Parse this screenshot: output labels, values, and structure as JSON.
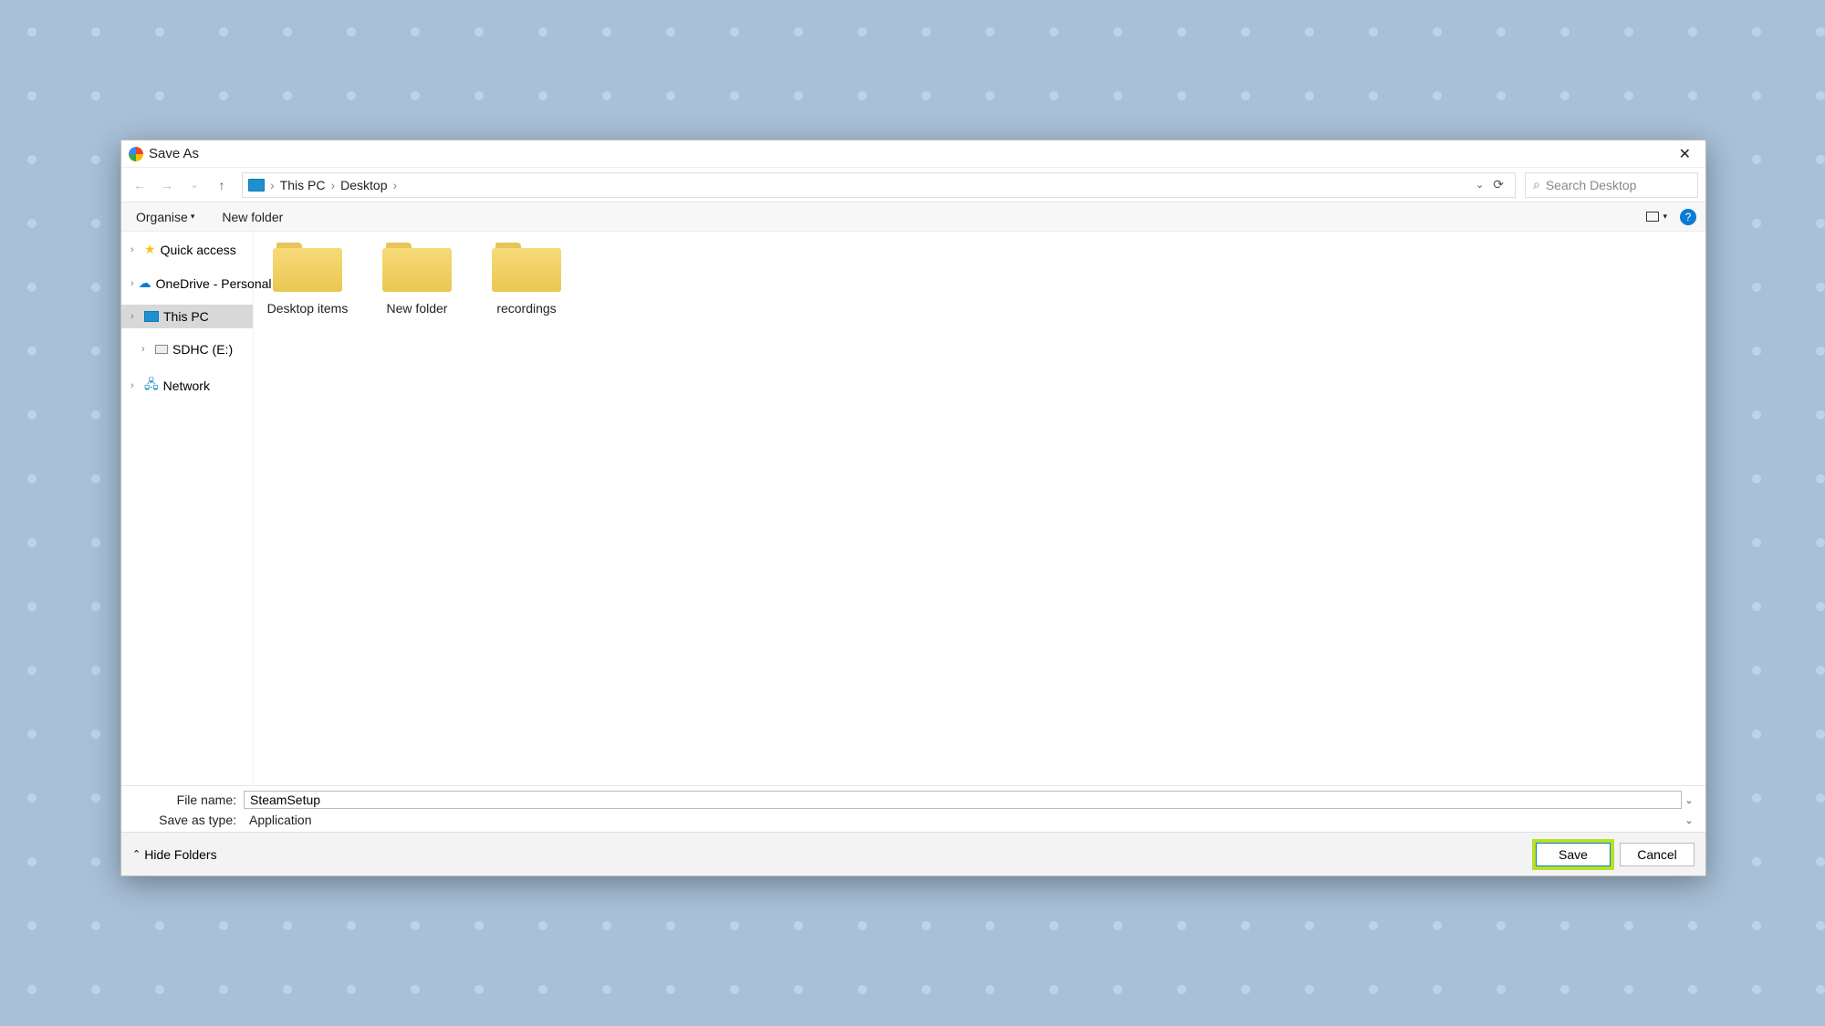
{
  "window": {
    "title": "Save As"
  },
  "breadcrumb": {
    "part1": "This PC",
    "part2": "Desktop"
  },
  "search": {
    "placeholder": "Search Desktop"
  },
  "toolbar": {
    "organise": "Organise",
    "new_folder": "New folder"
  },
  "sidebar": {
    "quick_access": "Quick access",
    "onedrive": "OneDrive - Personal",
    "this_pc": "This PC",
    "sdhc": "SDHC (E:)",
    "network": "Network"
  },
  "folders": [
    {
      "name": "Desktop items"
    },
    {
      "name": "New folder"
    },
    {
      "name": "recordings"
    }
  ],
  "fields": {
    "file_name_label": "File name:",
    "file_name_value": "SteamSetup",
    "save_type_label": "Save as type:",
    "save_type_value": "Application"
  },
  "footer": {
    "hide_folders": "Hide Folders",
    "save": "Save",
    "cancel": "Cancel"
  }
}
